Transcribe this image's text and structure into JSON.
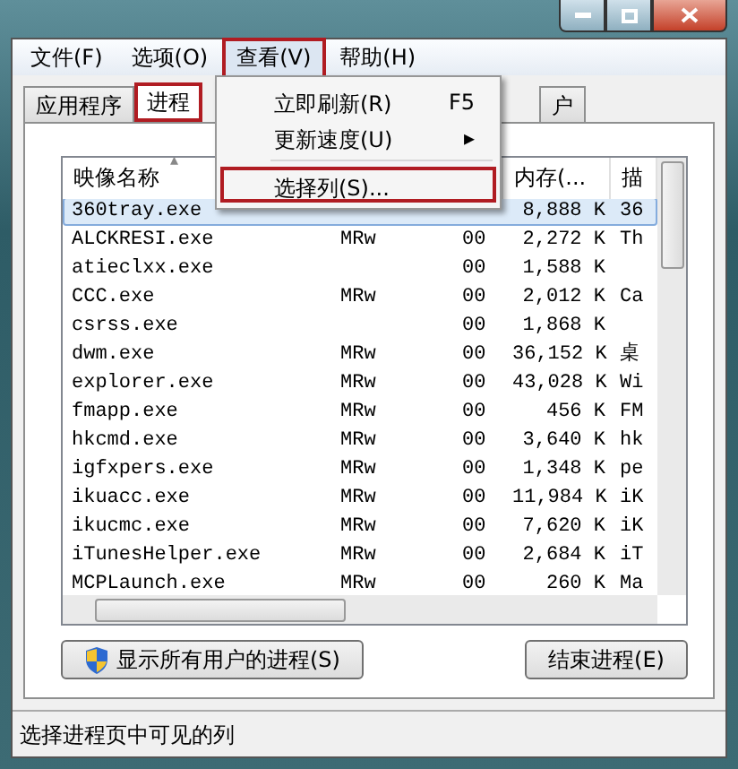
{
  "menu_bar": [
    {
      "label": "文件(F)",
      "open": false,
      "highlighted": false
    },
    {
      "label": "选项(O)",
      "open": false,
      "highlighted": false
    },
    {
      "label": "查看(V)",
      "open": true,
      "highlighted": true
    },
    {
      "label": "帮助(H)",
      "open": false,
      "highlighted": false
    }
  ],
  "menu": [
    {
      "kind": "item",
      "label": "立即刷新(R)",
      "shortcut": "F5",
      "highlighted": false
    },
    {
      "kind": "submenu",
      "label": "更新速度(U)",
      "arrow": "▸",
      "highlighted": false
    },
    {
      "kind": "separator"
    },
    {
      "kind": "item",
      "label": "选择列(S)...",
      "highlighted": true
    }
  ],
  "tabs": [
    {
      "label": "应用程序",
      "selected": false,
      "highlighted": false
    },
    {
      "label": "进程",
      "selected": true,
      "highlighted": true
    },
    {
      "label": "户",
      "selected": false,
      "highlighted": false
    }
  ],
  "table": {
    "columns": [
      {
        "label": "映像名称",
        "sort": "▴"
      },
      {},
      {},
      {
        "label": "内存(..."
      },
      {
        "label": "描"
      }
    ],
    "rows": [
      {
        "cells": [
          "360tray.exe",
          "",
          "",
          "8,888 K",
          "36"
        ],
        "selected": true
      },
      {
        "cells": [
          "ALCKRESI.exe",
          "MRw",
          "00",
          "2,272 K",
          "Th"
        ],
        "selected": false
      },
      {
        "cells": [
          "atieclxx.exe",
          "",
          "00",
          "1,588 K",
          ""
        ],
        "selected": false
      },
      {
        "cells": [
          "CCC.exe",
          "MRw",
          "00",
          "2,012 K",
          "Ca"
        ],
        "selected": false
      },
      {
        "cells": [
          "csrss.exe",
          "",
          "00",
          "1,868 K",
          ""
        ],
        "selected": false
      },
      {
        "cells": [
          "dwm.exe",
          "MRw",
          "00",
          "36,152 K",
          "桌"
        ],
        "selected": false
      },
      {
        "cells": [
          "explorer.exe",
          "MRw",
          "00",
          "43,028 K",
          "Wi"
        ],
        "selected": false
      },
      {
        "cells": [
          "fmapp.exe",
          "MRw",
          "00",
          "456 K",
          "FM"
        ],
        "selected": false
      },
      {
        "cells": [
          "hkcmd.exe",
          "MRw",
          "00",
          "3,640 K",
          "hk"
        ],
        "selected": false
      },
      {
        "cells": [
          "igfxpers.exe",
          "MRw",
          "00",
          "1,348 K",
          "pe"
        ],
        "selected": false
      },
      {
        "cells": [
          "ikuacc.exe",
          "MRw",
          "00",
          "11,984 K",
          "iK"
        ],
        "selected": false
      },
      {
        "cells": [
          "ikucmc.exe",
          "MRw",
          "00",
          "7,620 K",
          "iK"
        ],
        "selected": false
      },
      {
        "cells": [
          "iTunesHelper.exe",
          "MRw",
          "00",
          "2,684 K",
          "iT"
        ],
        "selected": false
      },
      {
        "cells": [
          "MCPLaunch.exe",
          "MRw",
          "00",
          "260 K",
          "Ma"
        ],
        "selected": false
      }
    ]
  },
  "buttons": [
    {
      "label": "显示所有用户的进程(S)",
      "shield": true
    },
    {
      "label": "结束进程(E)",
      "shield": false
    }
  ],
  "status_bar": "选择进程页中可见的列"
}
